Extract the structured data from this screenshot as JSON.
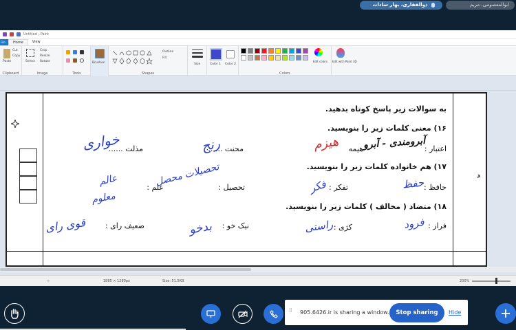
{
  "meeting": {
    "participants": [
      {
        "name": "ذوالفقاری، بهار سادات",
        "active": true
      },
      {
        "name": "ابوالمعصومی، مریم",
        "active": false
      }
    ]
  },
  "paint": {
    "title": "Untitled - Paint",
    "tabs": {
      "file": "File",
      "home": "Home",
      "view": "View"
    },
    "ribbon": {
      "groups": [
        "Clipboard",
        "Image",
        "Tools",
        "Shapes",
        "Colors"
      ],
      "clipboard": {
        "paste": "Paste",
        "cut": "Cut",
        "copy": "Copy"
      },
      "image": {
        "select": "Select",
        "crop": "Crop",
        "resize": "Resize",
        "rotate": "Rotate"
      },
      "brushes": "Brushes",
      "shapes": {
        "outline": "Outline",
        "fill": "Fill"
      },
      "size": "Size",
      "color1": "Color 1",
      "color2": "Color 2",
      "edit_colors": "Edit colors",
      "edit_paint3d": "Edit with Paint 3D",
      "palette": [
        "#000000",
        "#7f7f7f",
        "#880015",
        "#ed1c24",
        "#ff7f27",
        "#fff200",
        "#22b14c",
        "#00a2e8",
        "#3f48cc",
        "#a349a4",
        "#ffffff",
        "#c3c3c3",
        "#b97a57",
        "#ffaec9",
        "#ffc90e",
        "#efe4b0",
        "#b5e61d",
        "#99d9ea",
        "#7092be",
        "#c8bfe7"
      ]
    },
    "status": {
      "canvas_size": "1885 × 1280px",
      "file_size": "Size: 51.5KB",
      "zoom": "200%"
    }
  },
  "worksheet": {
    "section_letter": "د",
    "instruction": "به سوالات زیر پاسخ کوتاه بدهید.",
    "q16": {
      "title": "۱۶) معنی کلمات زیر را بنویسید.",
      "items": [
        "اعتبار :",
        "هیمه",
        "محنت ......",
        "مذلت ......"
      ],
      "answers": [
        "آبرومندی - آبرو",
        "هیزم",
        "رنج",
        "خواری"
      ]
    },
    "q17": {
      "title": "۱۷) هم خانواده کلمات زیر را بنویسید.",
      "items": [
        "حافظ :",
        "تفکر :",
        "تحصیل :",
        "علم :"
      ],
      "answers": [
        "حفظ",
        "فکر",
        "تحصیلات محصل",
        "عالم",
        "معلوم"
      ]
    },
    "q18": {
      "title": "۱۸) متضاد ( مخالف ) کلمات زیر را بنویسید.",
      "items": [
        "فراز :",
        "کژی :",
        "نیک خو :",
        "ضعیف رای :"
      ],
      "answers": [
        "فرود",
        "راستی",
        "بدخو",
        "قوی رای"
      ]
    }
  },
  "share": {
    "message": "905.6426.ir is sharing a window.",
    "stop_label": "Stop sharing",
    "hide_label": "Hide"
  },
  "colors": {
    "ink_blue": "#2a3fc7",
    "ink_red": "#d42a2a",
    "ink_black": "#111111",
    "accent": "#2563c9"
  }
}
